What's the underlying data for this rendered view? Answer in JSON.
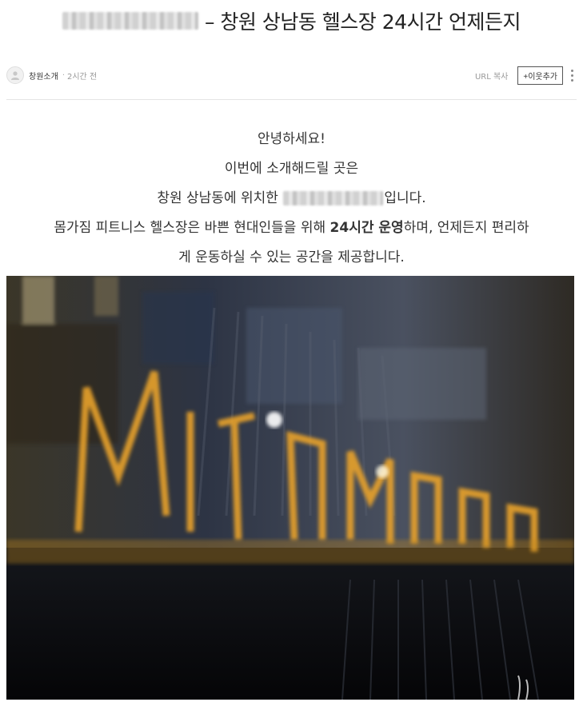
{
  "post": {
    "title_suffix": "– 창원 상남동 헬스장 24시간 언제든지"
  },
  "meta": {
    "author": "창원소개",
    "separator": "·",
    "time": "2시간 전",
    "url_copy": "URL 복사",
    "add_neighbor": "+이웃추가"
  },
  "content": {
    "line1": "안녕하세요!",
    "line2": "이번에 소개해드릴 곳은",
    "line3_pre": "창원 상남동에 위치한",
    "line3_post": "입니다.",
    "line4_pre": "몸가짐 피트니스 헬스장은 바쁜 현대인들을 위해 ",
    "line4_bold": "24시간 운영",
    "line4_post": "하며, 언제든지 편리하",
    "line5": "게 운동하실 수 있는 공간을 제공합니다."
  },
  "icons": {
    "avatar": "user-avatar-icon",
    "more": "more-vertical-icon"
  },
  "colors": {
    "sign_gold": "#e8a22a",
    "border": "#e5e5e5"
  }
}
